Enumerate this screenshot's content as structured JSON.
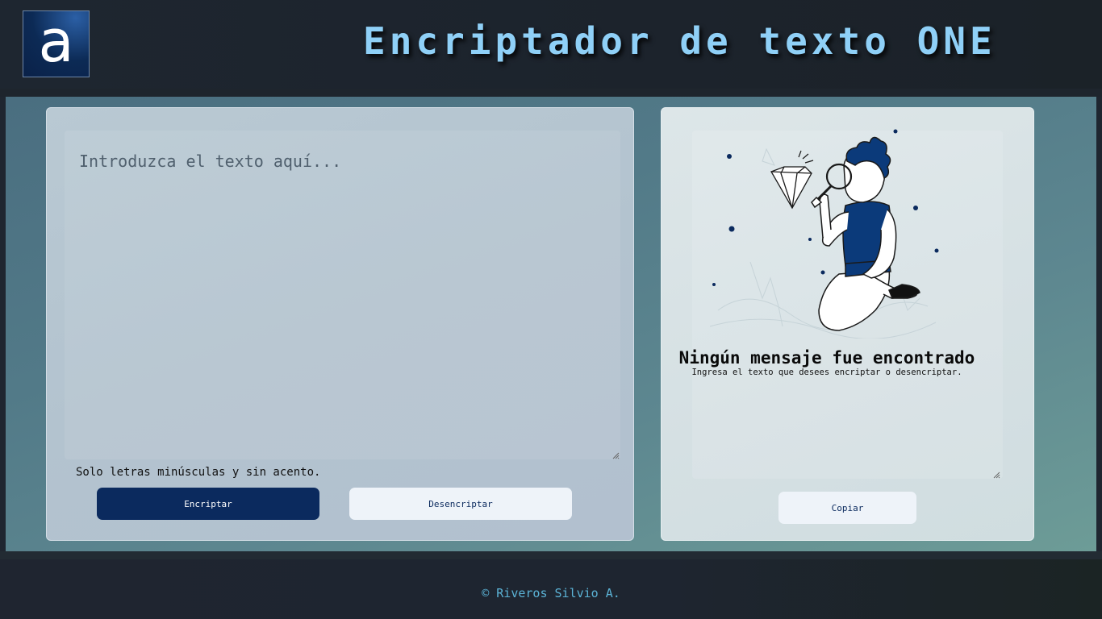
{
  "header": {
    "logo_letter": "a",
    "title": "Encriptador de texto ONE"
  },
  "input": {
    "placeholder": "Introduzca el texto aquí...",
    "hint": "Solo letras minúsculas y sin acento."
  },
  "buttons": {
    "encrypt": "Encriptar",
    "decrypt": "Desencriptar",
    "copy": "Copiar"
  },
  "output": {
    "empty_title": "Ningún mensaje fue encontrado",
    "empty_subtitle": "Ingresa el texto que desees encriptar o desencriptar.",
    "illustration": "person-with-magnifying-glass-and-diamond"
  },
  "footer": {
    "text": "© Riveros Silvio A."
  },
  "colors": {
    "title": "#8fd0f7",
    "primary_button": "#0b2a5e",
    "secondary_button": "#eef3f9",
    "footer_text": "#5bb3d6"
  }
}
